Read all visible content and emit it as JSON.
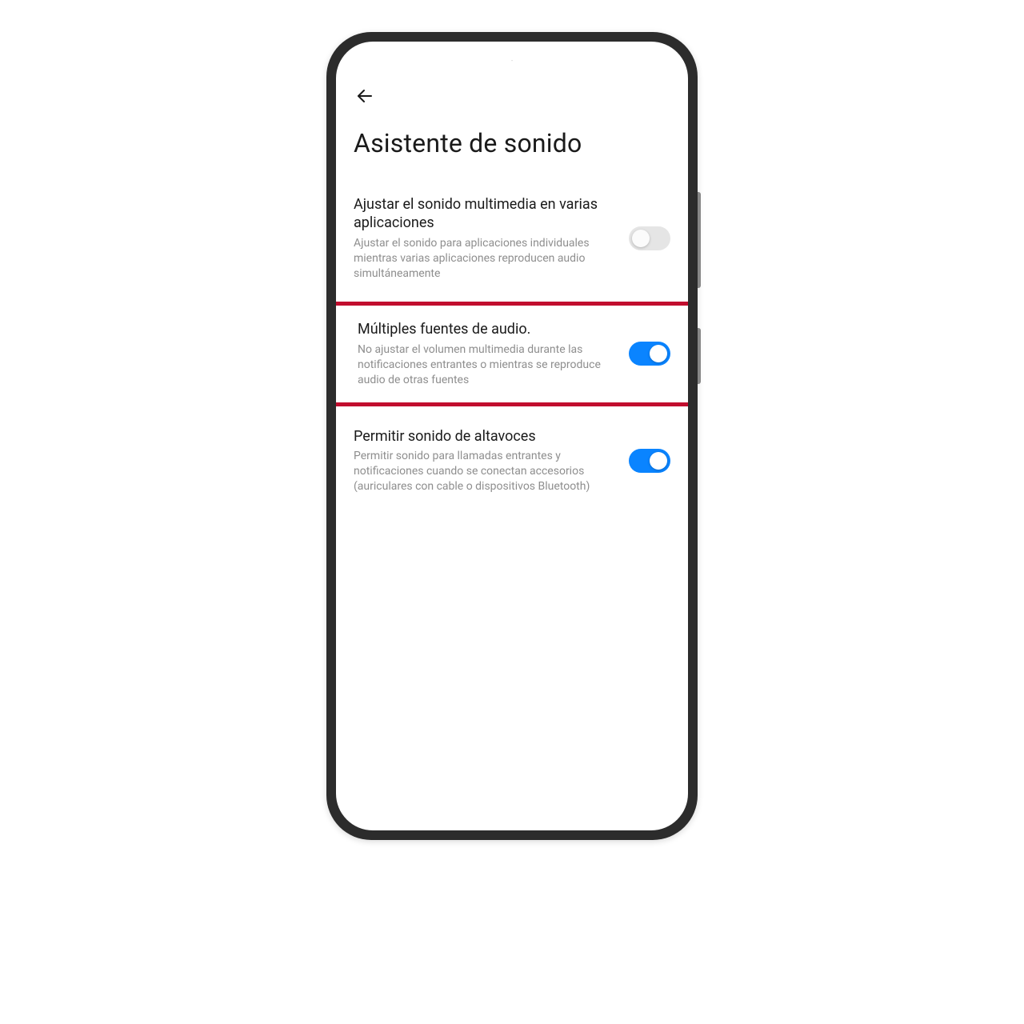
{
  "header": {
    "title": "Asistente de sonido"
  },
  "settings": [
    {
      "title": "Ajustar el sonido multimedia en varias aplicaciones",
      "desc": "Ajustar el sonido para aplicaciones individuales mientras varias aplicaciones reproducen audio simultáneamente",
      "on": false,
      "highlighted": false
    },
    {
      "title": "Múltiples fuentes de audio.",
      "desc": "No ajustar el volumen multimedia durante las notificaciones entrantes o mientras se reproduce audio de otras fuentes",
      "on": true,
      "highlighted": true
    },
    {
      "title": "Permitir sonido de altavoces",
      "desc": "Permitir sonido para llamadas entrantes y notificaciones cuando se conectan accesorios (auriculares con cable o dispositivos Bluetooth)",
      "on": true,
      "highlighted": false
    }
  ],
  "colors": {
    "accent": "#0a84ff",
    "highlight_border": "#c10e2e"
  }
}
